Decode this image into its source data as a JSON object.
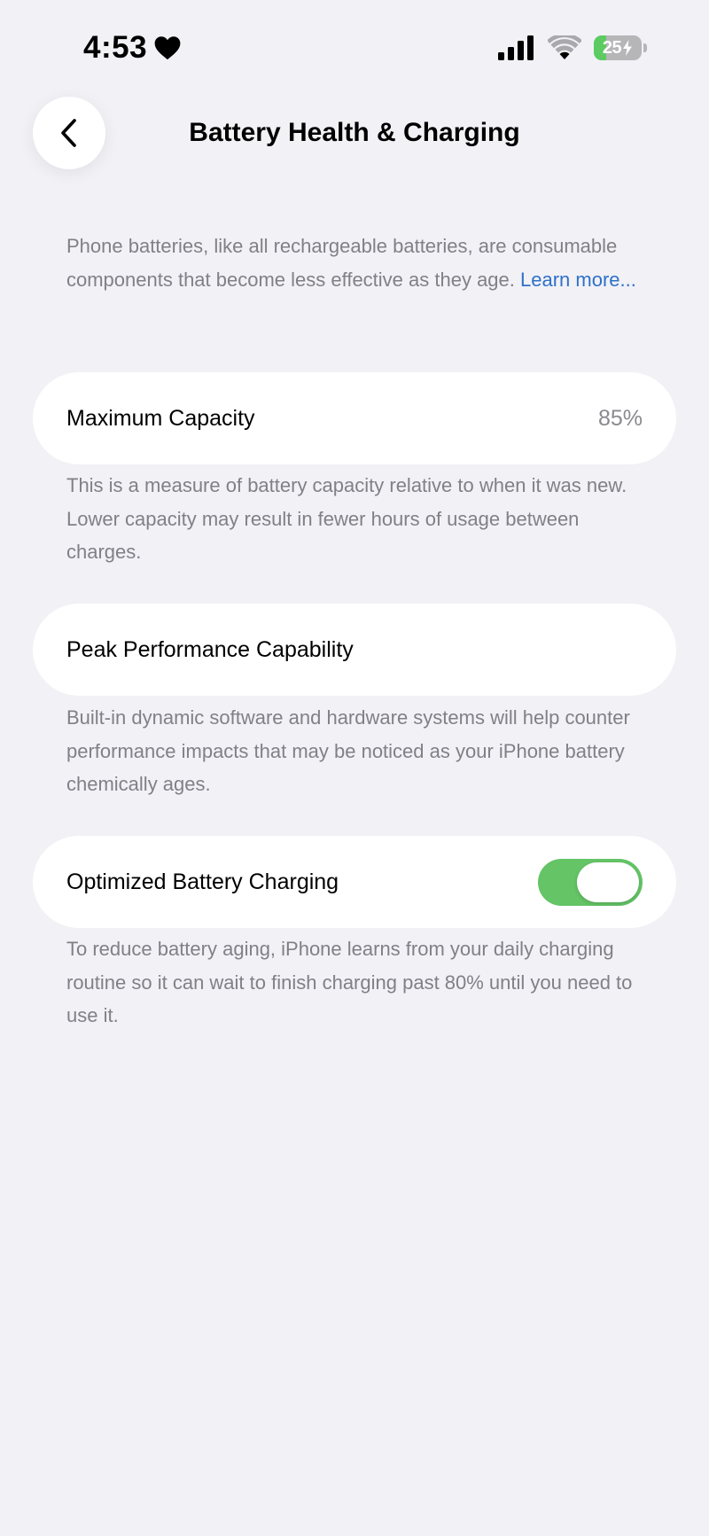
{
  "status_bar": {
    "time": "4:53",
    "battery_level": "25",
    "heart_icon": "heart-icon",
    "signal_icon": "cellular-signal-icon",
    "wifi_icon": "wifi-icon",
    "battery_icon": "battery-charging-icon"
  },
  "header": {
    "back_icon": "chevron-left-icon",
    "title": "Battery Health & Charging"
  },
  "intro": {
    "text": "Phone batteries, like all rechargeable batteries, are consumable components that become less effective as they age. ",
    "link": "Learn more..."
  },
  "maximum_capacity": {
    "label": "Maximum Capacity",
    "value": "85%",
    "description": "This is a measure of battery capacity relative to when it was new. Lower capacity may result in fewer hours of usage between charges."
  },
  "peak_performance": {
    "label": "Peak Performance Capability",
    "description": "Built-in dynamic software and hardware systems will help counter performance impacts that may be noticed as your iPhone battery chemically ages."
  },
  "optimized_charging": {
    "label": "Optimized Battery Charging",
    "enabled": true,
    "description": "To reduce battery aging, iPhone learns from your daily charging routine so it can wait to finish charging past 80% until you need to use it."
  },
  "colors": {
    "background": "#f1f1f6",
    "card": "#ffffff",
    "secondary_text": "#808086",
    "link": "#2f71c8",
    "toggle_on": "#64c466",
    "battery_fill": "#5ccb61"
  }
}
